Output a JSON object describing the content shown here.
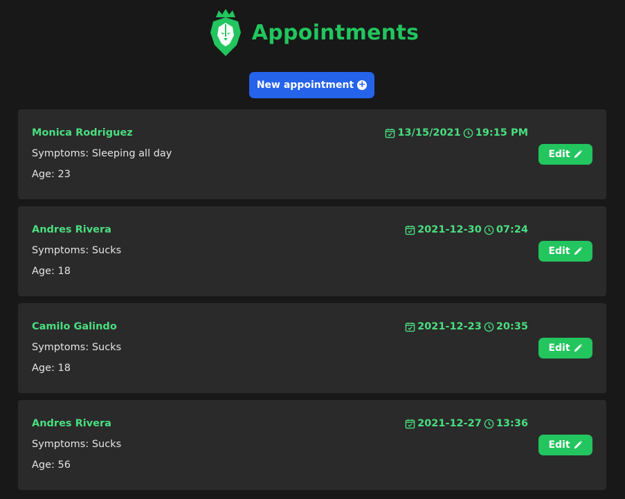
{
  "header": {
    "title": "Appointments",
    "logo_icon": "lion-crown-icon",
    "accent_color": "#22c55e"
  },
  "new_appointment_button": {
    "label": "New appointment",
    "icon": "plus-circle-icon",
    "color": "#2563eb"
  },
  "appointments": [
    {
      "name": "Monica Rodriguez",
      "symptoms": "Symptoms: Sleeping all day",
      "age": "Age: 23",
      "date": "13/15/2021",
      "time": "19:15 PM",
      "edit_label": "Edit"
    },
    {
      "name": "Andres Rivera",
      "symptoms": "Symptoms: Sucks",
      "age": "Age: 18",
      "date": "2021-12-30",
      "time": "07:24",
      "edit_label": "Edit"
    },
    {
      "name": "Camilo Galindo",
      "symptoms": "Symptoms: Sucks",
      "age": "Age: 18",
      "date": "2021-12-23",
      "time": "20:35",
      "edit_label": "Edit"
    },
    {
      "name": "Andres Rivera",
      "symptoms": "Symptoms: Sucks",
      "age": "Age: 56",
      "date": "2021-12-27",
      "time": "13:36",
      "edit_label": "Edit"
    }
  ],
  "icons": {
    "date": "calendar-check-icon",
    "time": "clock-icon",
    "edit": "pencil-icon"
  }
}
